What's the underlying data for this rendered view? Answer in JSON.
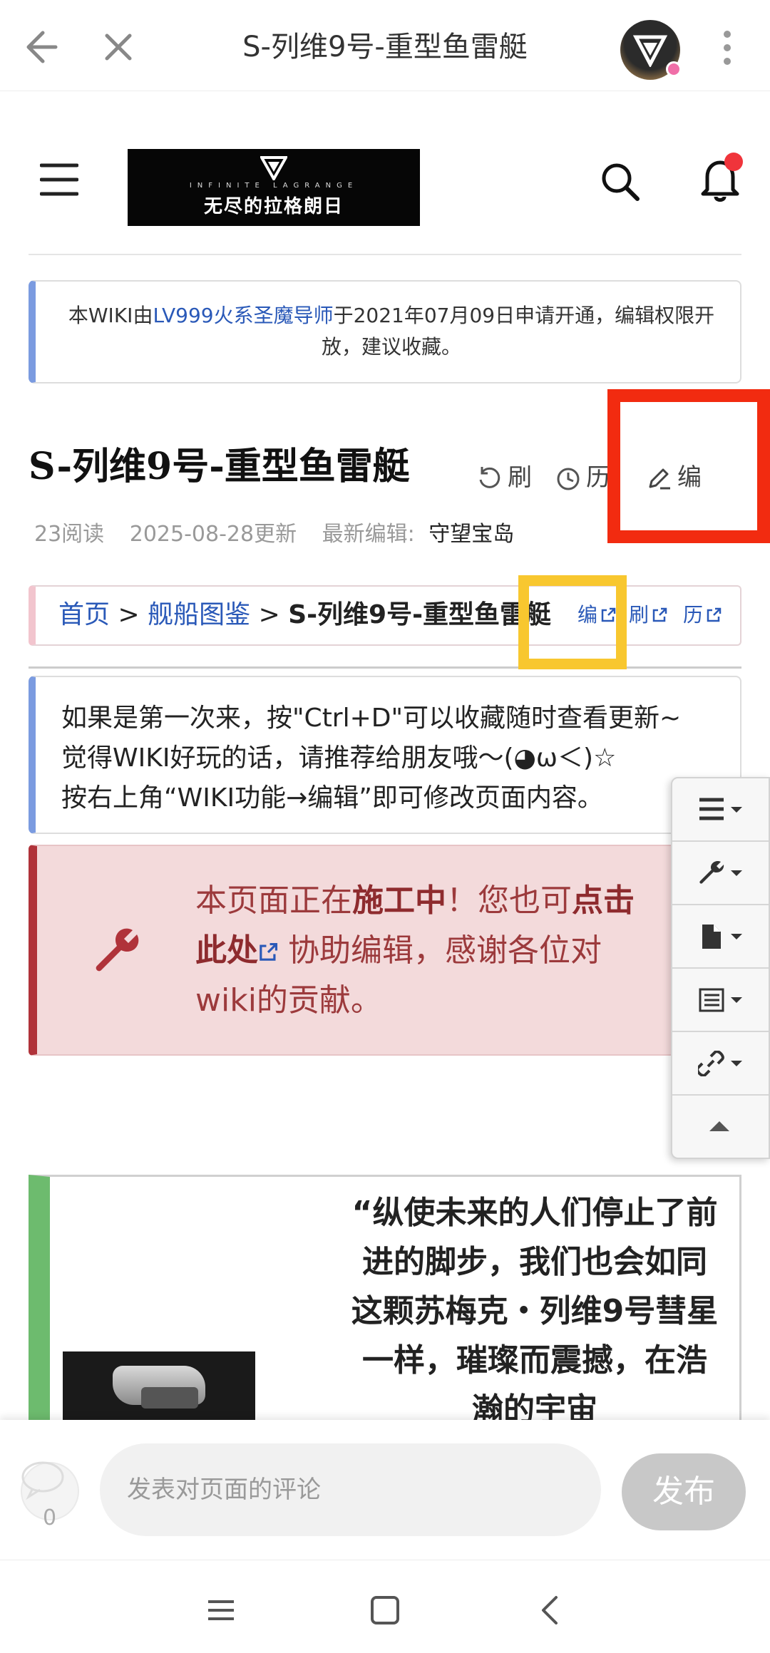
{
  "browser": {
    "title": "S-列维9号-重型鱼雷艇"
  },
  "site": {
    "logo_sub": "INFINITE        LAGRANGE",
    "logo_name": "无尽的拉格朗日"
  },
  "notice": {
    "prefix": "本WIKI由",
    "user_link": "LV999火系圣魔导师",
    "suffix": "于2021年07月09日申请开通，编辑权限开放，建议收藏。"
  },
  "page": {
    "title": "S-列维9号-重型鱼雷艇",
    "actions": {
      "refresh": "刷",
      "history": "历",
      "edit": "编"
    },
    "meta": {
      "reads": "23阅读",
      "updated": "2025-08-28更新",
      "editor_label": "最新编辑:",
      "editor": "守望宝岛"
    }
  },
  "breadcrumb": {
    "home": "首页",
    "sep": ">",
    "category": "舰船图鉴",
    "current": "S-列维9号-重型鱼雷艇",
    "edit": "编",
    "refresh": "刷",
    "history": "历"
  },
  "tips": {
    "line1": "如果是第一次来，按\"Ctrl+D\"可以收藏随时查看更新~",
    "line2": "觉得WIKI好玩的话，请推荐给朋友哦～(◕ω＜)☆",
    "line3": "按右上角“WIKI功能→编辑”即可修改页面内容。"
  },
  "construction": {
    "part1": "本页面正在",
    "bold1": "施工中",
    "part2": "！您也可",
    "bold2": "点击此处",
    "part3": " 协助编辑，感谢各位对wiki的贡献。"
  },
  "quote": {
    "text": "“纵使未来的人们停止了前进的脚步，我们也会如同这颗苏梅克・列维9号彗星一样，璀璨而震撼，在浩瀚的宇宙"
  },
  "comment": {
    "count": "0",
    "placeholder": "发表对页面的评论",
    "publish": "发布"
  },
  "colors": {
    "link": "#2a59b8",
    "highlight_red": "#f22b10",
    "highlight_yellow": "#f8c72f",
    "notice_border": "#7b9be0",
    "construction_bg": "#f3dadb",
    "quote_border": "#6dbb6e"
  },
  "icons": [
    "back-arrow-icon",
    "close-icon",
    "avatar-icon",
    "more-vert-icon",
    "menu-icon",
    "search-icon",
    "bell-icon",
    "refresh-icon",
    "history-icon",
    "edit-pencil-icon",
    "external-link-icon",
    "wrench-icon",
    "list-icon",
    "file-icon",
    "table-icon",
    "link-icon",
    "chevron-up-icon",
    "comment-icon",
    "nav-menu-icon",
    "nav-home-icon",
    "nav-back-icon"
  ]
}
